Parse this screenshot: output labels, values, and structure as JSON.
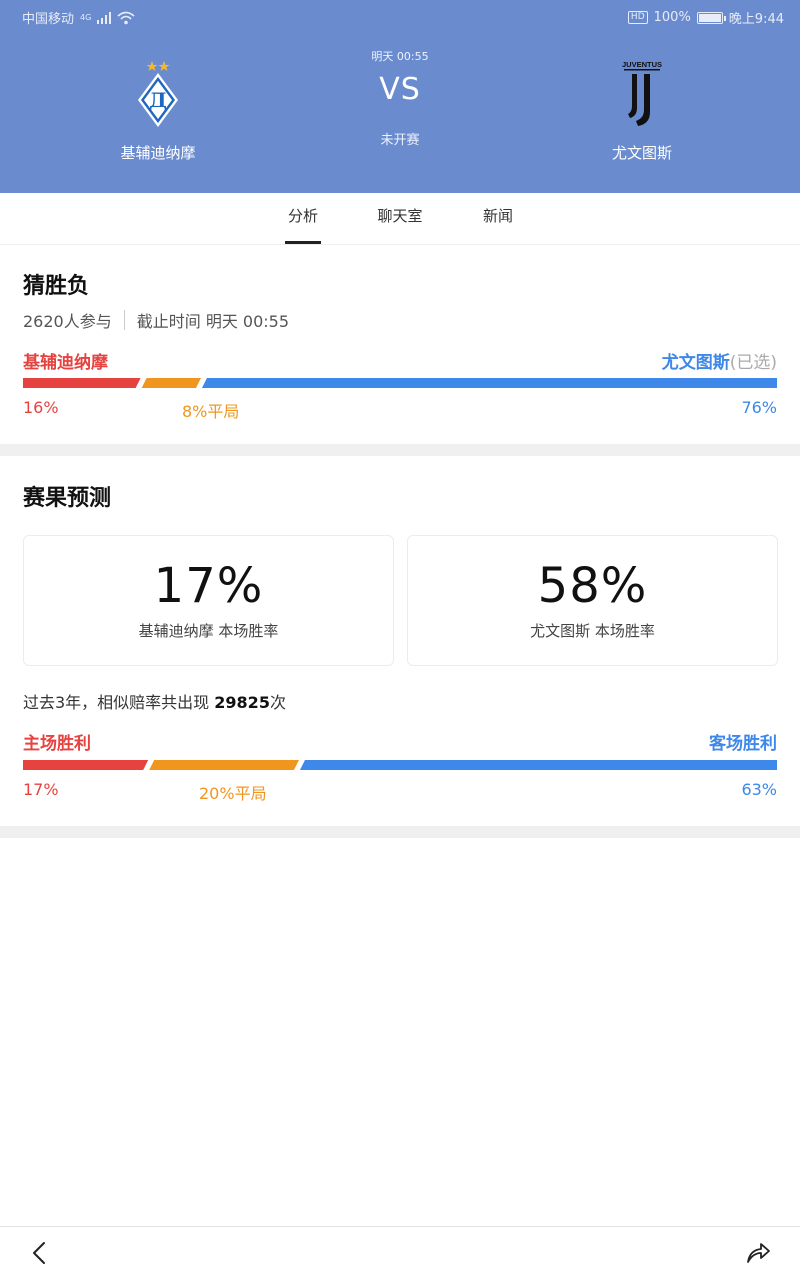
{
  "status_bar": {
    "carrier": "中国移动",
    "network": "4G",
    "battery_pct": "100%",
    "time": "晚上9:44"
  },
  "match": {
    "home_team": "基辅迪纳摩",
    "away_team": "尤文图斯",
    "time": "明天 00:55",
    "vs": "VS",
    "status": "未开赛",
    "away_logo_text": "JUVENTUS"
  },
  "tabs": [
    {
      "label": "分析",
      "active": true
    },
    {
      "label": "聊天室",
      "active": false
    },
    {
      "label": "新闻",
      "active": false
    }
  ],
  "guess": {
    "title": "猜胜负",
    "participants": "2620人参与",
    "deadline": "截止时间 明天 00:55",
    "home_label": "基辅迪纳摩",
    "away_label": "尤文图斯",
    "away_chosen": "(已选)",
    "home_pct": "16%",
    "draw_pct": "8%平局",
    "away_pct": "76%",
    "split": {
      "home": 16,
      "draw": 8,
      "away": 76
    }
  },
  "prediction": {
    "title": "赛果预测",
    "home_pct": "17%",
    "home_caption": "基辅迪纳摩 本场胜率",
    "away_pct": "58%",
    "away_caption": "尤文图斯 本场胜率",
    "history_prefix": "过去3年，相似赔率共出现 ",
    "history_count": "29825",
    "history_suffix": "次",
    "home_label": "主场胜利",
    "away_label": "客场胜利",
    "hist_home_pct": "17%",
    "hist_draw_pct": "20%平局",
    "hist_away_pct": "63%",
    "split": {
      "home": 17,
      "draw": 20,
      "away": 63
    }
  },
  "colors": {
    "header_bg": "#6a8ccf",
    "home": "#e64340",
    "draw": "#f0961e",
    "away": "#3d88e8"
  },
  "icons": {
    "back": "chevron-left-icon",
    "share": "share-icon"
  }
}
